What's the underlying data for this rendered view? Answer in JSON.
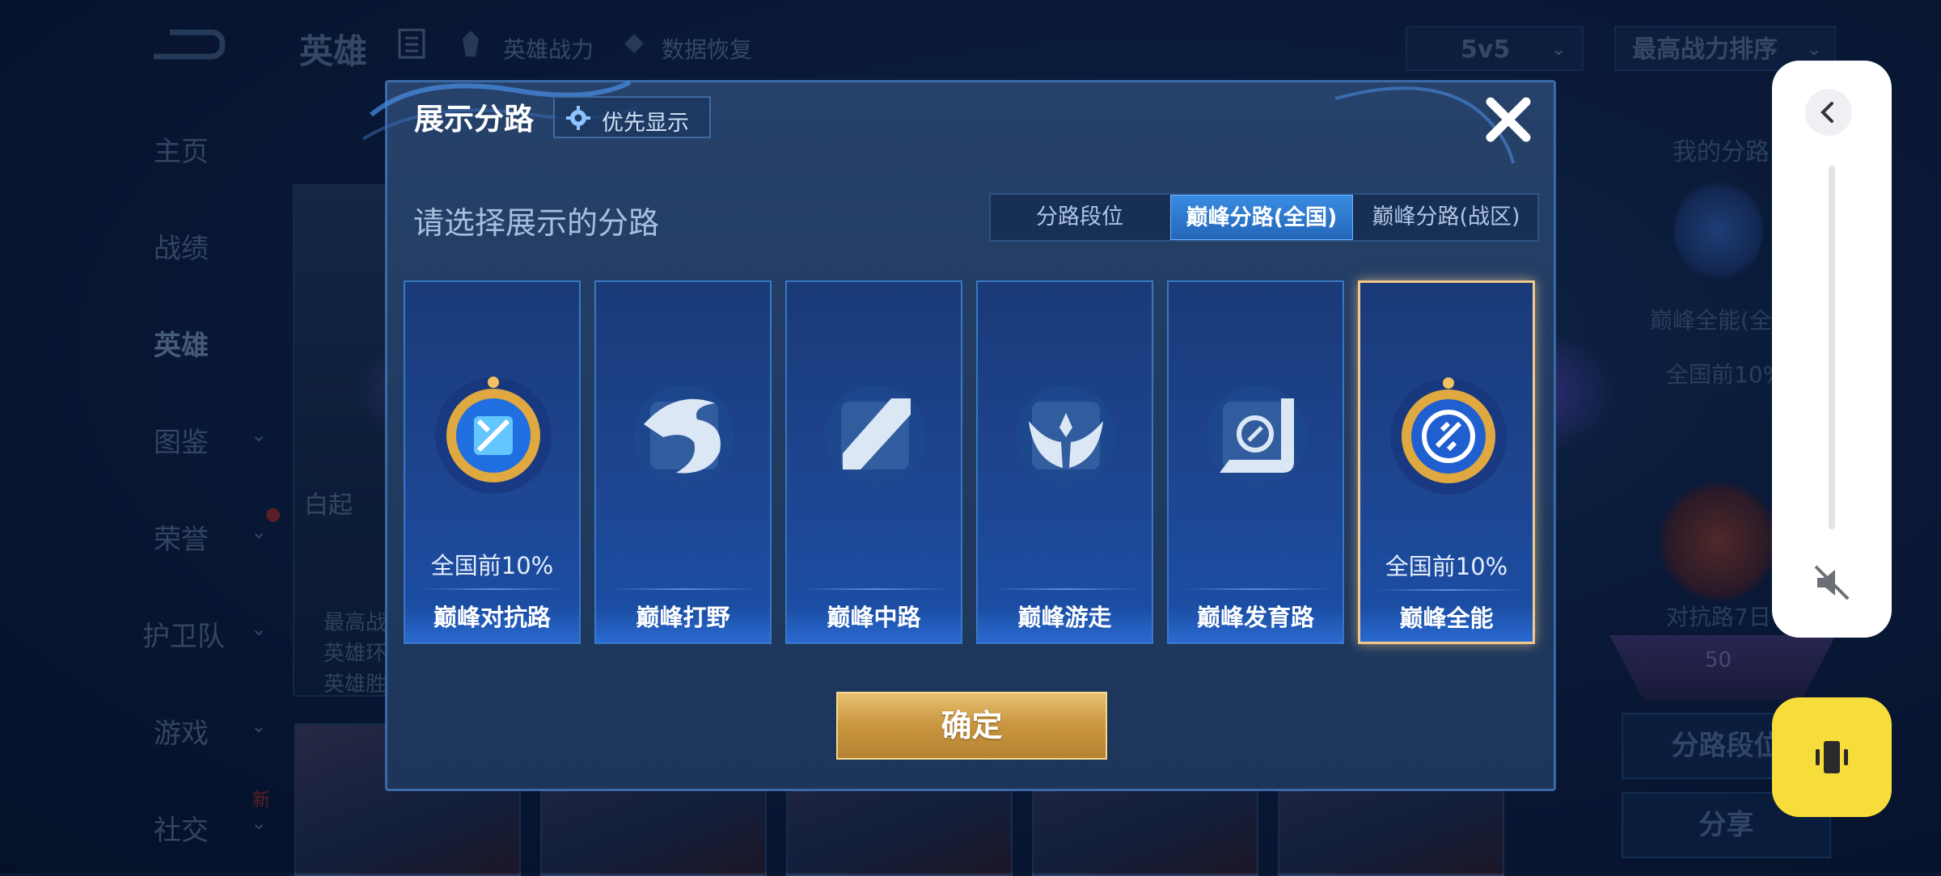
{
  "background": {
    "top_title": "英雄",
    "top_links": [
      "英雄战力",
      "数据恢复"
    ],
    "mode_select": "5v5",
    "sort_select": "最高战力排序",
    "sidebar": [
      {
        "label": "主页",
        "chevron": false
      },
      {
        "label": "战绩",
        "chevron": false
      },
      {
        "label": "英雄",
        "chevron": false,
        "active": true
      },
      {
        "label": "图鉴",
        "chevron": true
      },
      {
        "label": "荣誉",
        "chevron": true
      },
      {
        "label": "护卫队",
        "chevron": true
      },
      {
        "label": "游戏",
        "chevron": true
      },
      {
        "label": "社交",
        "chevron": true,
        "badge": "新"
      }
    ],
    "hero_name": "白起",
    "hero_info": [
      "最高战",
      "英雄环",
      "英雄胜"
    ],
    "right_panel": {
      "title": "我的分路",
      "lane_label": "巅峰全能(全",
      "lane_rank": "全国前10%",
      "lane2_label": "对抗路7日",
      "level": "50",
      "button1": "分路段位",
      "button2": "分享"
    }
  },
  "dialog": {
    "title": "展示分路",
    "priority_button": "优先显示",
    "subtitle": "请选择展示的分路",
    "tabs": [
      {
        "label": "分路段位",
        "active": false
      },
      {
        "label": "巅峰分路(全国)",
        "active": true
      },
      {
        "label": "巅峰分路(战区)",
        "active": false
      }
    ],
    "lanes": [
      {
        "name": "巅峰对抗路",
        "rank": "全国前10%",
        "icon": "sword-lane-icon",
        "ranked": true,
        "selected": false
      },
      {
        "name": "巅峰打野",
        "rank": "",
        "icon": "dragon-jungle-icon",
        "ranked": false,
        "selected": false
      },
      {
        "name": "巅峰中路",
        "rank": "",
        "icon": "staff-mid-icon",
        "ranked": false,
        "selected": false
      },
      {
        "name": "巅峰游走",
        "rank": "",
        "icon": "wings-support-icon",
        "ranked": false,
        "selected": false
      },
      {
        "name": "巅峰发育路",
        "rank": "",
        "icon": "bow-marksman-icon",
        "ranked": false,
        "selected": false
      },
      {
        "name": "巅峰全能",
        "rank": "全国前10%",
        "icon": "all-round-icon",
        "ranked": true,
        "selected": true
      }
    ],
    "confirm_button": "确定"
  },
  "colors": {
    "accent_blue": "#2366b9",
    "gold": "#c9953f",
    "selected_border": "#f2c98a",
    "vibrate_yellow": "#f6dd3a"
  }
}
